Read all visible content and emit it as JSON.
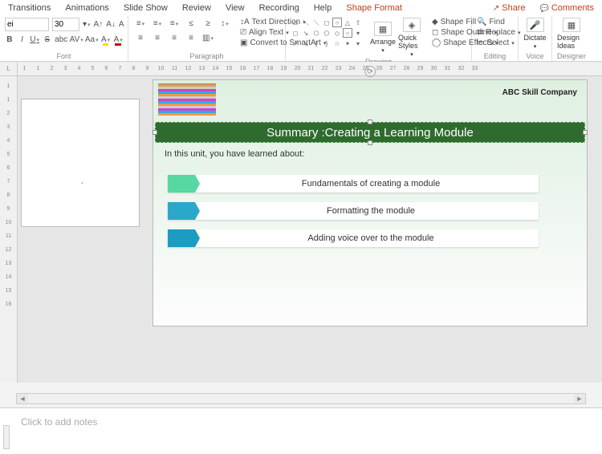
{
  "tabs": {
    "transitions": "Transitions",
    "animations": "Animations",
    "slideshow": "Slide Show",
    "review": "Review",
    "view": "View",
    "recording": "Recording",
    "help": "Help",
    "shapeformat": "Shape Format",
    "share": "Share",
    "comments": "Comments"
  },
  "font": {
    "family": "ei",
    "size": "30",
    "grow": "A↑",
    "shrink": "A↓",
    "clear": "A",
    "bold": "B",
    "italic": "I",
    "underline": "U",
    "strike": "S",
    "shadow": "abc",
    "spacing": "AV",
    "case": "Aa",
    "highlight": "A",
    "color": "A",
    "label": "Font"
  },
  "para": {
    "bullets": "≡",
    "numbers": "≡",
    "levels": "≡",
    "dec": "≤",
    "inc": "≥",
    "spacing": "↕",
    "left": "≡",
    "center": "≡",
    "right": "≡",
    "just": "≡",
    "cols": "▥",
    "textdir": "Text Direction",
    "align": "Align Text",
    "smartart": "Convert to SmartArt",
    "label": "Paragraph"
  },
  "draw": {
    "arrange": "Arrange",
    "quick": "Quick Styles",
    "fill": "Shape Fill",
    "outline": "Shape Outline",
    "effects": "Shape Effects",
    "label": "Drawing"
  },
  "editing": {
    "find": "Find",
    "replace": "Replace",
    "select": "Select",
    "label": "Editing"
  },
  "voice": {
    "dictate": "Dictate",
    "label": "Voice"
  },
  "designer": {
    "ideas": "Design Ideas",
    "label": "Designer"
  },
  "ruler": [
    "1",
    "1",
    "2",
    "3",
    "4",
    "5",
    "6",
    "7",
    "8",
    "9",
    "10",
    "11",
    "12",
    "13",
    "14",
    "15",
    "16",
    "17",
    "18",
    "19",
    "20",
    "21",
    "22",
    "23",
    "24",
    "25",
    "26",
    "27",
    "28",
    "29",
    "30",
    "31",
    "32",
    "33"
  ],
  "vruler": [
    "1",
    "1",
    "2",
    "3",
    "4",
    "5",
    "6",
    "7",
    "8",
    "9",
    "10",
    "11",
    "12",
    "13",
    "14",
    "15",
    "16"
  ],
  "slide": {
    "company": "ABC Skill Company",
    "title": "Summary :Creating a Learning Module",
    "intro": "In this unit, you have learned about:",
    "b1": "Fundamentals of creating a module",
    "b2": "Formatting the module",
    "b3": "Adding voice over to the module"
  },
  "notes": {
    "placeholder": "Click to add notes"
  },
  "ruler_corner": "L"
}
